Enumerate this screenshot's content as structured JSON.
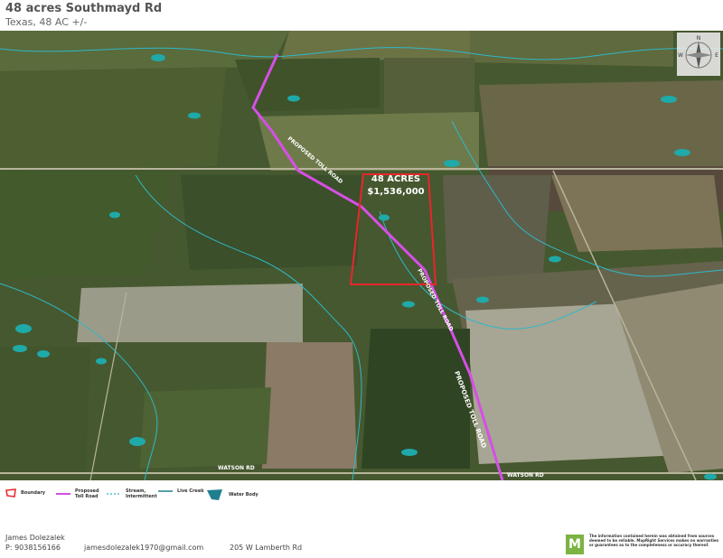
{
  "header": {
    "title": "48 acres Southmayd Rd",
    "subtitle": "Texas, 48 AC +/-"
  },
  "map": {
    "parcel_label": "48 ACRES",
    "parcel_price": "$1,536,000",
    "road_labels": {
      "proposed_toll_road": "PROPOSED TOLL ROAD",
      "watson_rd": "WATSON RD"
    },
    "compass_letters": {
      "n": "N",
      "e": "E",
      "w": "W"
    },
    "colors": {
      "boundary": "#e8262c",
      "toll_road": "#d64fe6",
      "stream": "#2fb8c8",
      "water": "#1fa9a9"
    }
  },
  "legend": {
    "items": [
      {
        "label": "Boundary",
        "icon": "boundary-polygon-icon"
      },
      {
        "label": "Proposed Toll Road",
        "icon": "magenta-line-icon"
      },
      {
        "label": "Stream, Intermittent",
        "icon": "dashed-line-icon"
      },
      {
        "label": "Live Creek",
        "icon": "solid-line-icon"
      },
      {
        "label": "Water Body",
        "icon": "water-polygon-icon"
      }
    ]
  },
  "footer": {
    "agent_name": "James Dolezalek",
    "phone": "P: 9038156166",
    "email": "jamesdolezalek1970@gmail.com",
    "address": "205 W Lamberth Rd",
    "logo_letter": "M",
    "disclaimer": "The information contained herein was obtained from sources deemed to be reliable. MapRight Services makes no warranties or guarantees as to the completeness or accuracy thereof."
  }
}
